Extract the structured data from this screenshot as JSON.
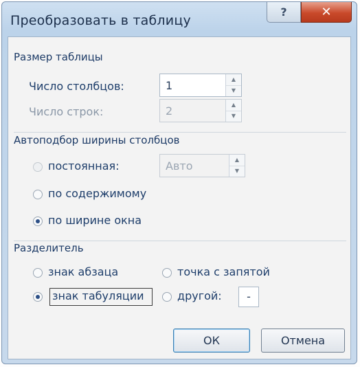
{
  "title": "Преобразовать в таблицу",
  "titlebar": {
    "help": "?",
    "close": "✕"
  },
  "table_size": {
    "group_label": "Размер таблицы",
    "columns_label": "Число столбцов:",
    "columns_value": "1",
    "rows_label": "Число строк:",
    "rows_value": "2"
  },
  "autofit": {
    "group_label": "Автоподбор ширины столбцов",
    "fixed_label": "постоянная:",
    "fixed_value": "Авто",
    "contents_label": "по содержимому",
    "window_label": "по ширине окна",
    "selected": "window"
  },
  "separator": {
    "group_label": "Разделитель",
    "paragraph_label": "знак абзаца",
    "semicolon_label": "точка с запятой",
    "tab_label": "знак табуляции",
    "other_label": "другой:",
    "other_value": "-",
    "selected": "tab"
  },
  "buttons": {
    "ok": "ОК",
    "cancel": "Отмена"
  }
}
